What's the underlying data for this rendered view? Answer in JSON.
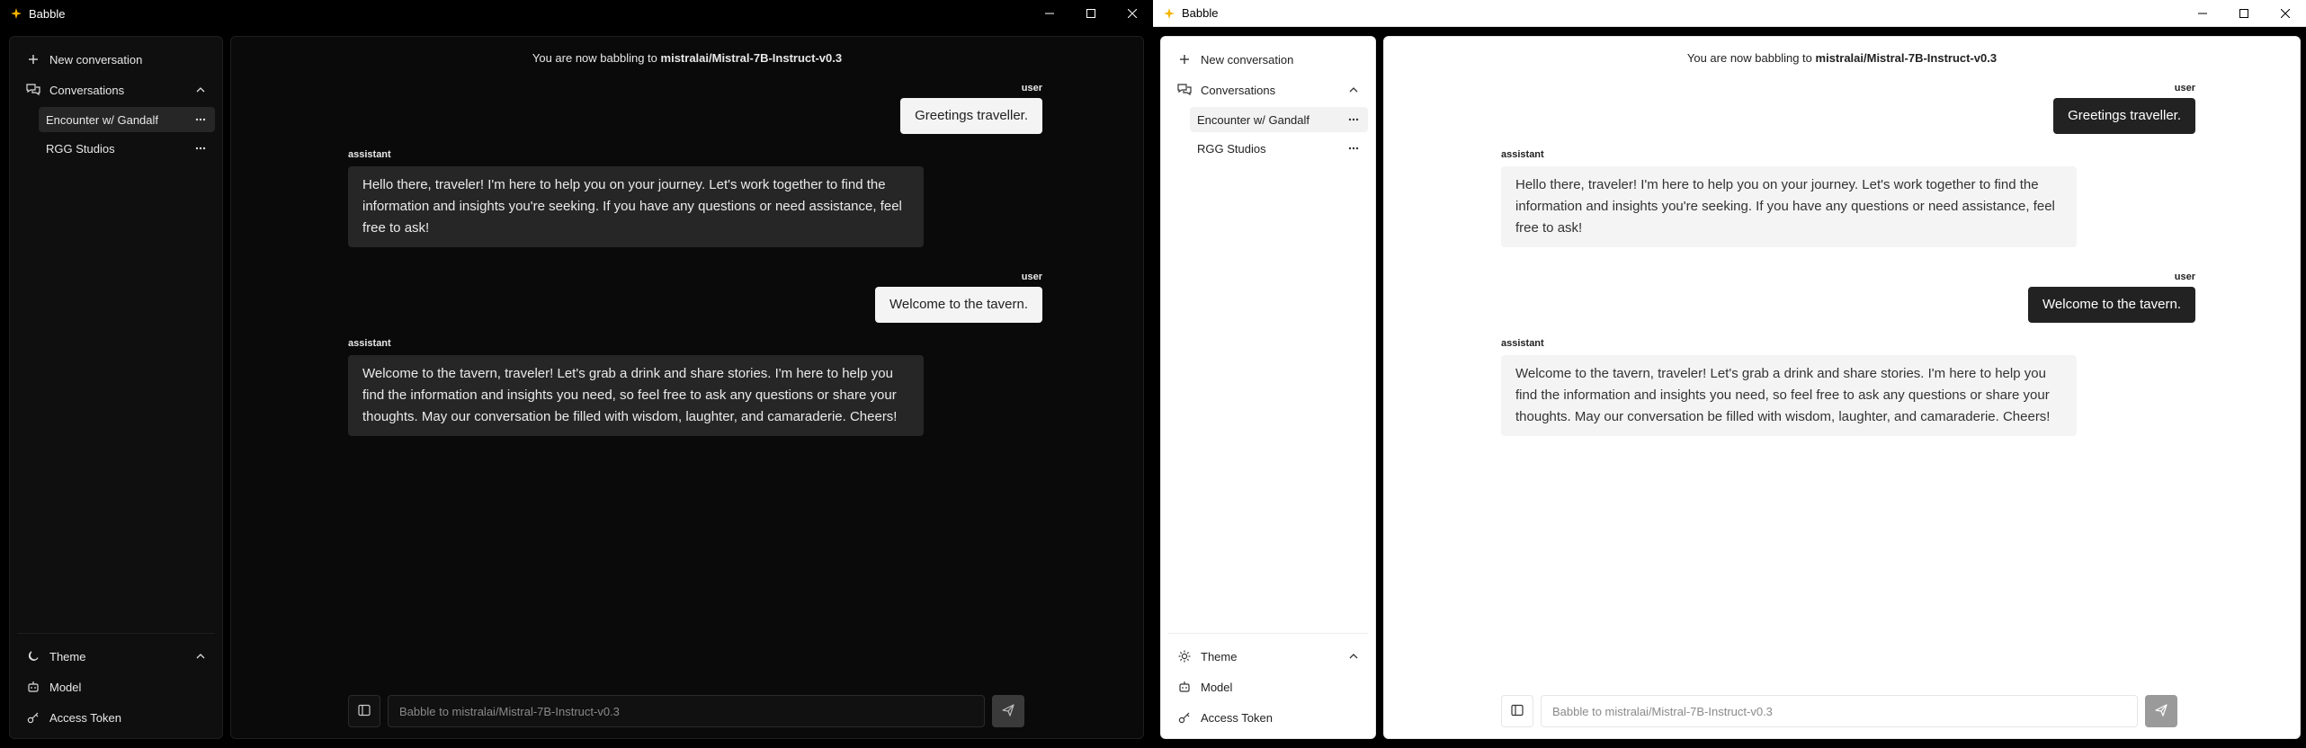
{
  "app": {
    "title": "Babble",
    "accent": "#f5b400"
  },
  "sidebar": {
    "new_conversation": "New conversation",
    "conversations_label": "Conversations",
    "conversations": [
      {
        "label": "Encounter w/ Gandalf"
      },
      {
        "label": "RGG Studios"
      }
    ],
    "theme_label": "Theme",
    "model_label": "Model",
    "access_token_label": "Access Token"
  },
  "chat": {
    "banner_prefix": "You are now babbling to",
    "model_name": "mistralai/Mistral-7B-Instruct-v0.3",
    "messages": [
      {
        "role": "user",
        "text": "Greetings traveller."
      },
      {
        "role": "assistant",
        "text": "Hello there, traveler! I'm here to help you on your journey. Let's work together to find the information and insights you're seeking. If you have any questions or need assistance, feel free to ask!"
      },
      {
        "role": "user",
        "text": "Welcome to the tavern."
      },
      {
        "role": "assistant",
        "text": "Welcome to the tavern, traveler! Let's grab a drink and share stories. I'm here to help you find the information and insights you need, so feel free to ask any questions or share your thoughts. May our conversation be filled with wisdom, laughter, and camaraderie. Cheers!"
      }
    ],
    "input_placeholder": "Babble to mistralai/Mistral-7B-Instruct-v0.3"
  }
}
